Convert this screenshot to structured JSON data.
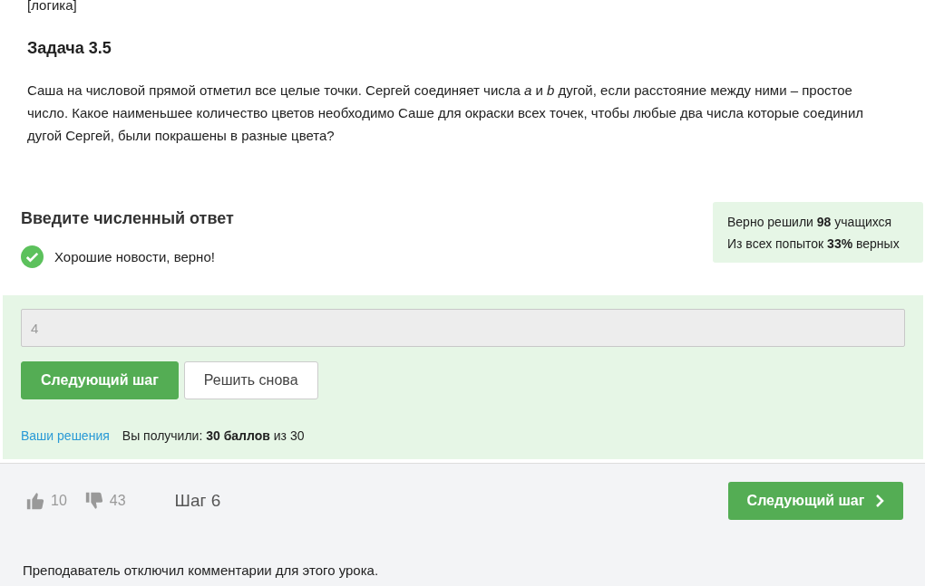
{
  "tag": "[логика]",
  "task": {
    "title": "Задача 3.5",
    "text": "Саша на числовой прямой отметил все целые точки. Сергей соединяет числа *a* и *b* дугой, если расстояние между ними – простое число. Какое наименьшее количество цветов необходимо Саше для окраски всех точек, чтобы любые два числа которые соединил дугой Сергей, были покрашены в разные цвета?"
  },
  "answer": {
    "heading": "Введите численный ответ",
    "feedback": {
      "correct": true,
      "text": "Хорошие новости, верно!"
    },
    "stats": [
      "Верно решили **98** учащихся",
      "Из всех попыток **33%** верных"
    ],
    "input": {
      "value": "4",
      "disabled": true
    },
    "buttons": [
      {
        "label": "Следующий шаг",
        "kind": "primary"
      },
      {
        "label": "Решить снова",
        "kind": "secondary"
      }
    ],
    "solutions_link": "Ваши решения",
    "score": "Вы получили: **30 баллов** из 30"
  },
  "footer": {
    "likes": "10",
    "dislikes": "43",
    "step": "Шаг 6",
    "next_button": "Следующий шаг",
    "comments_note": "Преподаватель отключил комментарии для этого урока."
  }
}
